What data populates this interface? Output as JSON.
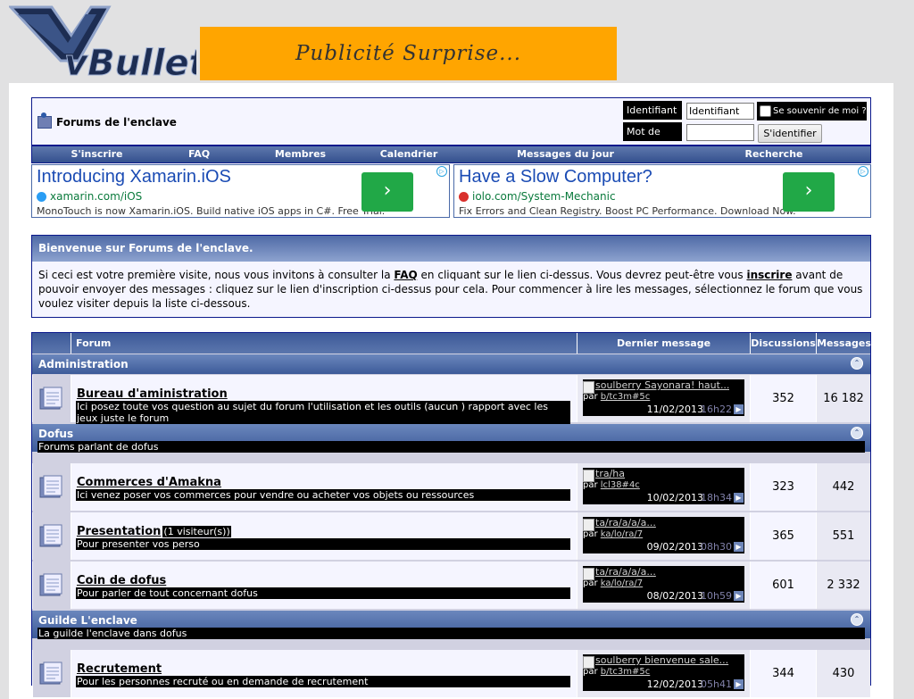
{
  "header": {
    "logo_text": "vBulletin",
    "banner_text": "Publicité Surprise..."
  },
  "navbar": {
    "forum_title": "Forums de l'enclave",
    "login": {
      "username_label": "Identifiant",
      "username_value": "Identifiant",
      "password_label": "Mot de passe",
      "remember_label": "Se souvenir de moi ?",
      "submit_label": "S'identifier"
    },
    "links": [
      "S'inscrire",
      "FAQ",
      "Membres",
      "Calendrier",
      "Messages du jour",
      "Recherche"
    ]
  },
  "ads": [
    {
      "title": "Introducing Xamarin.iOS",
      "url": "xamarin.com/iOS",
      "desc": "MonoTouch is now Xamarin.iOS. Build native iOS apps in C#. Free Trial.",
      "go": "›"
    },
    {
      "title": "Have a Slow Computer?",
      "url": "iolo.com/System-Mechanic",
      "desc": "Fix Errors and Clean Registry. Boost PC Performance. Download Now.",
      "go": "›"
    }
  ],
  "welcome": {
    "heading": "Bienvenue sur Forums de l'enclave.",
    "text_1": "Si ceci est votre première visite, nous vous invitons à consulter la ",
    "faq_link": "FAQ",
    "text_2": " en cliquant sur le lien ci-dessus. Vous devrez peut-être vous ",
    "register_link": "inscrire",
    "text_3": " avant de pouvoir envoyer des messages : cliquez sur le lien d'inscription ci-dessus pour cela. Pour commencer à lire les messages, sélectionnez le forum que vous voulez visiter depuis la liste ci-dessous."
  },
  "table": {
    "columns": {
      "forum": "Forum",
      "last_post": "Dernier message",
      "threads": "Discussions",
      "posts": "Messages"
    },
    "categories": [
      {
        "title": "Administration",
        "desc": "",
        "forums": [
          {
            "name": "Bureau d'aministration",
            "viewers": "",
            "desc": "Ici posez toute vos question au sujet du forum l'utilisation et les outils (aucun ) rapport avec les jeux juste le forum",
            "last_title": "soulberry Sayonara! haut...",
            "by": "par",
            "last_user": "b/tc3m#5c",
            "date": "11/02/2013",
            "time": "16h22",
            "threads": "352",
            "posts": "16 182"
          }
        ]
      },
      {
        "title": "Dofus",
        "desc": "Forums parlant de dofus",
        "forums": [
          {
            "name": "Commerces d'Amakna",
            "viewers": "",
            "desc": "Ici venez poser vos commerces pour vendre ou acheter vos objets ou ressources",
            "last_title": "tra/ha",
            "by": "par",
            "last_user": "lcl38#4c",
            "date": "10/02/2013",
            "time": "18h34",
            "threads": "323",
            "posts": "442"
          },
          {
            "name": "Presentation",
            "viewers": "(1 visiteur(s))",
            "desc": "Pour presenter vos perso",
            "last_title": "ta/ra/a/a/a...",
            "by": "par",
            "last_user": "ka/lo/ra/7",
            "date": "09/02/2013",
            "time": "08h30",
            "threads": "365",
            "posts": "551"
          },
          {
            "name": "Coin de dofus",
            "viewers": "",
            "desc": "Pour parler de tout concernant dofus",
            "last_title": "ta/ra/a/a/a...",
            "by": "par",
            "last_user": "ka/lo/ra/7",
            "date": "08/02/2013",
            "time": "10h59",
            "threads": "601",
            "posts": "2 332"
          }
        ]
      },
      {
        "title": "Guilde L'enclave",
        "desc": "La guilde l'enclave dans dofus",
        "forums": [
          {
            "name": "Recrutement",
            "viewers": "",
            "desc": "Pour les personnes recruté ou en demande de recrutement",
            "last_title": "soulberry bienvenue sale...",
            "by": "par",
            "last_user": "b/tc3m#5c",
            "date": "12/02/2013",
            "time": "05h41",
            "threads": "344",
            "posts": "430"
          }
        ]
      }
    ]
  }
}
